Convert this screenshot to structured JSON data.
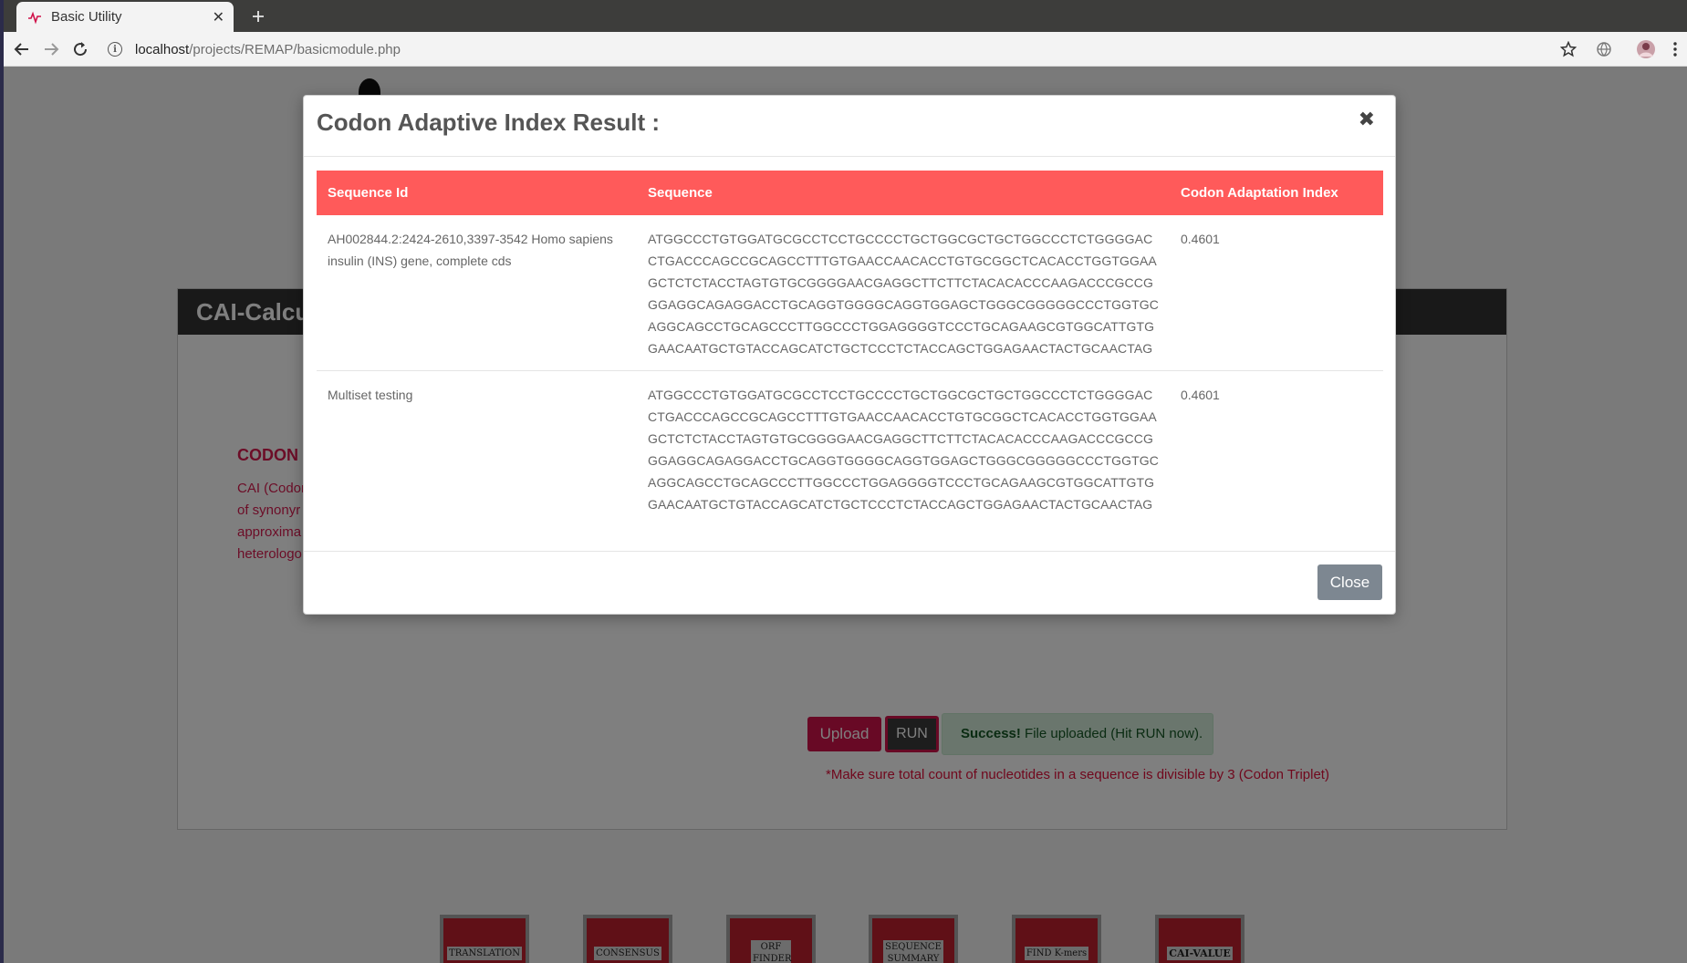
{
  "browser": {
    "tab_title": "Basic Utility",
    "url_host": "localhost",
    "url_path": "/projects/REMAP/basicmodule.php"
  },
  "page": {
    "panel_title": "CAI-Calcu",
    "section_heading": "CODON",
    "description_lines": [
      "CAI (Codon",
      "of synonyr",
      "approxima",
      "heterologo"
    ],
    "upload_label": "Upload",
    "run_label": "RUN",
    "success_strong": "Success!",
    "success_text": " File uploaded (Hit RUN now).",
    "note": "*Make sure total count of nucleotides in a sequence is divisible by 3 (Codon Triplet)",
    "modules": [
      {
        "label": "TRANSLATION"
      },
      {
        "label": "CONSENSUS"
      },
      {
        "label": "ORF FINDER"
      },
      {
        "label": "SEQUENCE SUMMARY"
      },
      {
        "label": "FIND K-mers"
      },
      {
        "label": "CAI-VALUE"
      }
    ]
  },
  "modal": {
    "title": "Codon Adaptive Index Result :",
    "close_label": "Close",
    "columns": [
      "Sequence Id",
      "Sequence",
      "Codon Adaptation Index"
    ],
    "rows": [
      {
        "id": "AH002844.2:2424-2610,3397-3542 Homo sapiens insulin (INS) gene, complete cds",
        "sequence": "ATGGCCCTGTGGATGCGCCTCCTGCCCCTGCTGGCGCTGCTGGCCCTCTGGGGACCTGACCCAGCCGCAGCCTTTGTGAACCAACACCTGTGCGGCTCACACCTGGTGGAAGCTCTCTACCTAGTGTGCGGGGAACGAGGCTTCTTCTACACACCCAAGACCCGCCGGGAGGCAGAGGACCTGCAGGTGGGGCAGGTGGAGCTGGGCGGGGGCCCTGGTGCAGGCAGCCTGCAGCCCTTGGCCCTGGAGGGGTCCCTGCAGAAGCGTGGCATTGTGGAACAATGCTGTACCAGCATCTGCTCCCTCTACCAGCTGGAGAACTACTGCAACTAG",
        "cai": "0.4601"
      },
      {
        "id": "Multiset testing",
        "sequence": "ATGGCCCTGTGGATGCGCCTCCTGCCCCTGCTGGCGCTGCTGGCCCTCTGGGGACCTGACCCAGCCGCAGCCTTTGTGAACCAACACCTGTGCGGCTCACACCTGGTGGAAGCTCTCTACCTAGTGTGCGGGGAACGAGGCTTCTTCTACACACCCAAGACCCGCCGGGAGGCAGAGGACCTGCAGGTGGGGCAGGTGGAGCTGGGCGGGGGCCCTGGTGCAGGCAGCCTGCAGCCCTTGGCCCTGGAGGGGTCCCTGCAGAAGCGTGGCATTGTGGAACAATGCTGTACCAGCATCTGCTCCCTCTACCAGCTGGAGAACTACTGCAACTAG",
        "cai": "0.4601"
      }
    ]
  },
  "icons": {
    "favicon": "heartbeat-icon",
    "back": "arrow-left-icon",
    "forward": "arrow-right-icon",
    "reload": "reload-icon",
    "info": "info-icon",
    "bookmark": "star-icon",
    "translate": "globe-icon",
    "profile": "avatar-icon",
    "menu": "kebab-menu-icon"
  },
  "colors": {
    "table_header": "#ff5a5a",
    "upload": "#d0124a",
    "accent_text": "#d81b4f",
    "module_tile": "#c0202f",
    "close_button": "#7d8791"
  }
}
